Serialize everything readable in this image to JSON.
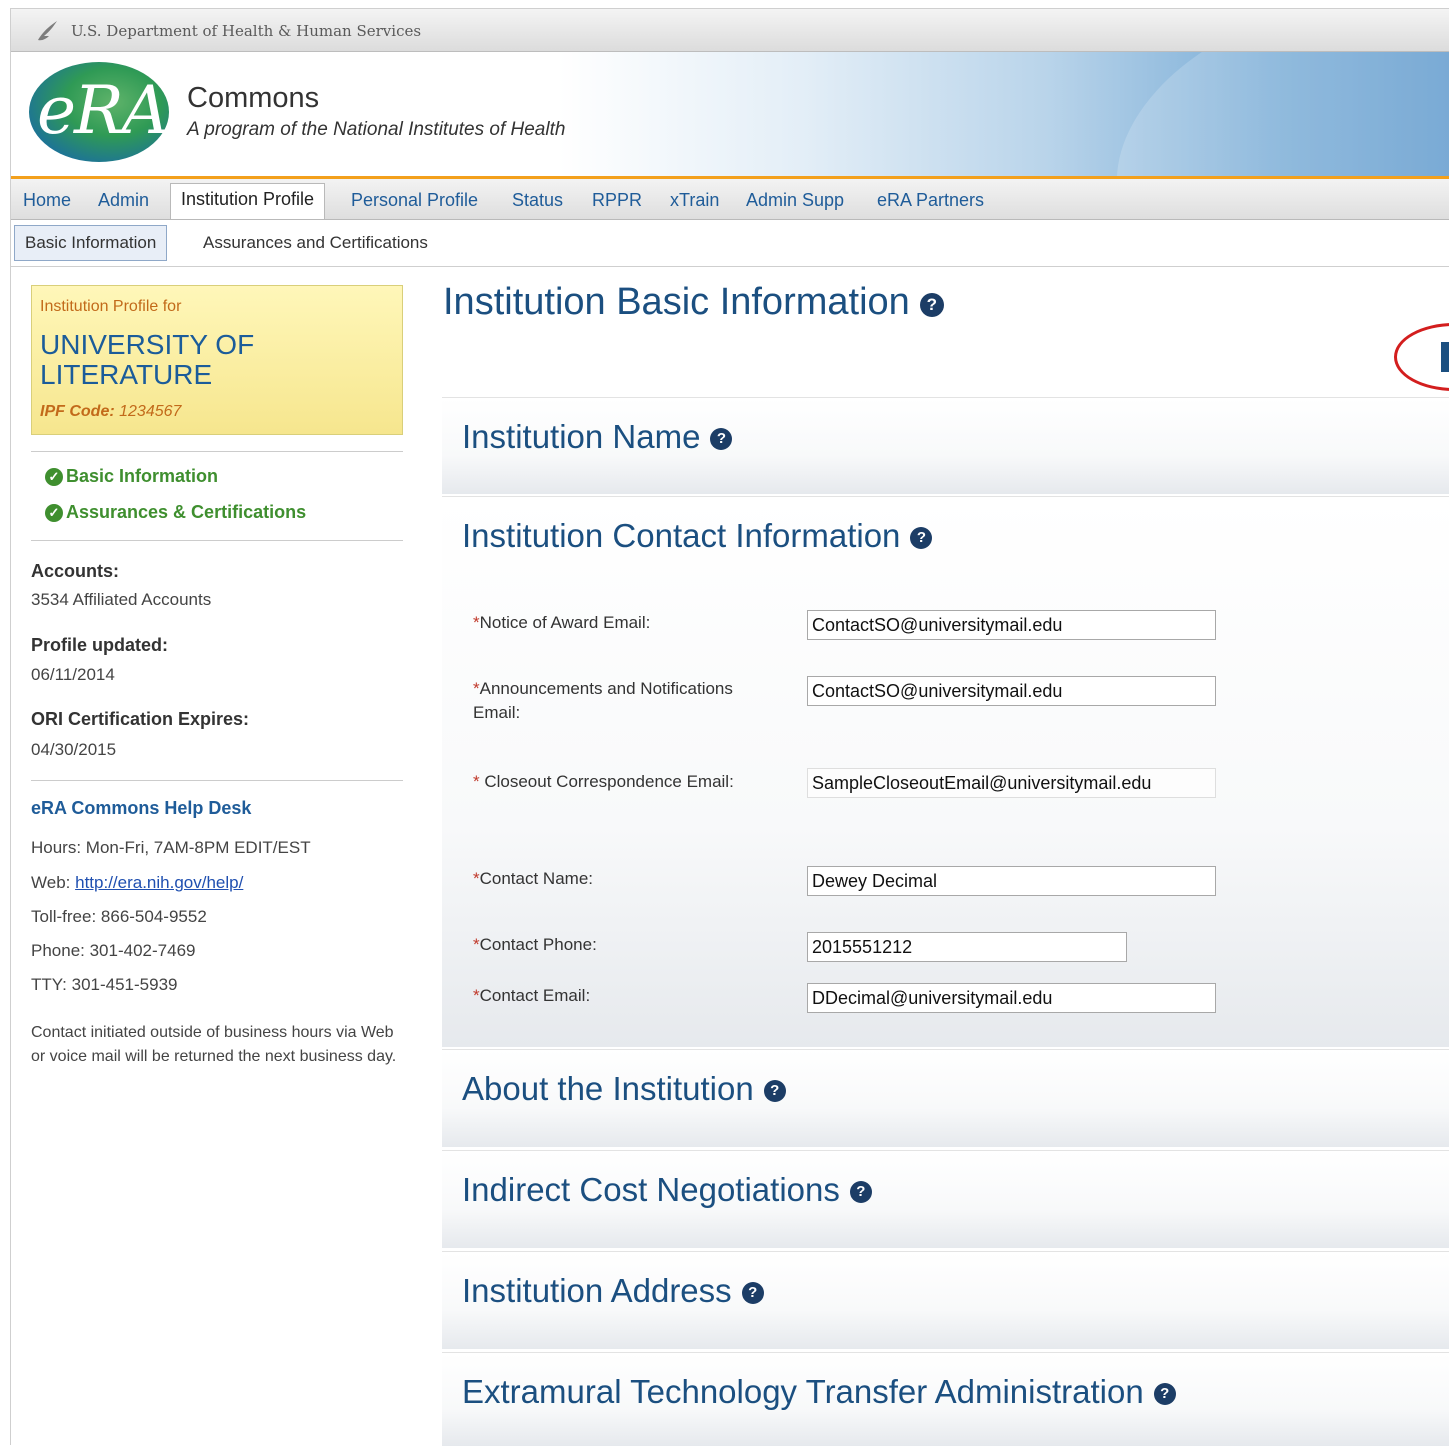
{
  "header": {
    "department": "U.S. Department of Health & Human Services",
    "app_name": "Commons",
    "tagline": "A program of the National Institutes of Health",
    "logo_text": "eRA"
  },
  "nav": {
    "items": [
      "Home",
      "Admin",
      "Institution Profile",
      "Personal Profile",
      "Status",
      "RPPR",
      "xTrain",
      "Admin Supp",
      "eRA Partners"
    ],
    "active": "Institution Profile"
  },
  "subnav": {
    "items": [
      "Basic Information",
      "Assurances and Certifications"
    ],
    "active": "Basic Information"
  },
  "sidebar": {
    "profile_for": "Institution Profile for",
    "institution_name": "UNIVERSITY OF LITERATURE",
    "ipf_label": "IPF Code:",
    "ipf_code": "1234567",
    "links": [
      "Basic Information",
      "Assurances & Certifications"
    ],
    "accounts_label": "Accounts:",
    "accounts_value": "3534 Affiliated Accounts",
    "updated_label": "Profile updated:",
    "updated_value": "06/11/2014",
    "ori_label": "ORI Certification Expires:",
    "ori_value": "04/30/2015",
    "help": {
      "title": "eRA Commons Help Desk",
      "hours": "Hours: Mon-Fri, 7AM-8PM EDIT/EST",
      "web_label": "Web:",
      "web_url": "http://era.nih.gov/help/",
      "tollfree": "Toll-free: 866-504-9552",
      "phone": "Phone: 301-402-7469",
      "tty": "TTY: 301-451-5939",
      "note": "Contact initiated outside of business hours via Web or voice mail will be returned the next business day."
    }
  },
  "main": {
    "title": "Institution Basic Information",
    "sections": {
      "name": "Institution Name",
      "contact": "Institution Contact Information",
      "about": "About the Institution",
      "indirect": "Indirect Cost Negotiations",
      "address": "Institution Address",
      "extramural": "Extramural Technology Transfer Administration"
    },
    "fields": {
      "noa_label": "Notice of Award Email:",
      "noa_value": "ContactSO@universitymail.edu",
      "ann_label_1": "Announcements and Notifications",
      "ann_label_2": "Email:",
      "ann_value": "ContactSO@universitymail.edu",
      "closeout_label": " Closeout Correspondence Email:",
      "closeout_value": "SampleCloseoutEmail@universitymail.edu",
      "name_label": "Contact Name:",
      "name_value": "Dewey Decimal",
      "phone_label": "Contact Phone:",
      "phone_value": "2015551212",
      "email_label": "Contact Email:",
      "email_value": "DDecimal@universitymail.edu",
      "required_marker": "*"
    }
  },
  "icons": {
    "help": "question-circle-icon",
    "check": "check-circle-icon"
  },
  "colors": {
    "link": "#1f5c99",
    "heading": "#1b4f80",
    "check": "#3f8f2f",
    "accent_orange": "#f3a01c",
    "highlight_circle": "#d31e1e"
  }
}
